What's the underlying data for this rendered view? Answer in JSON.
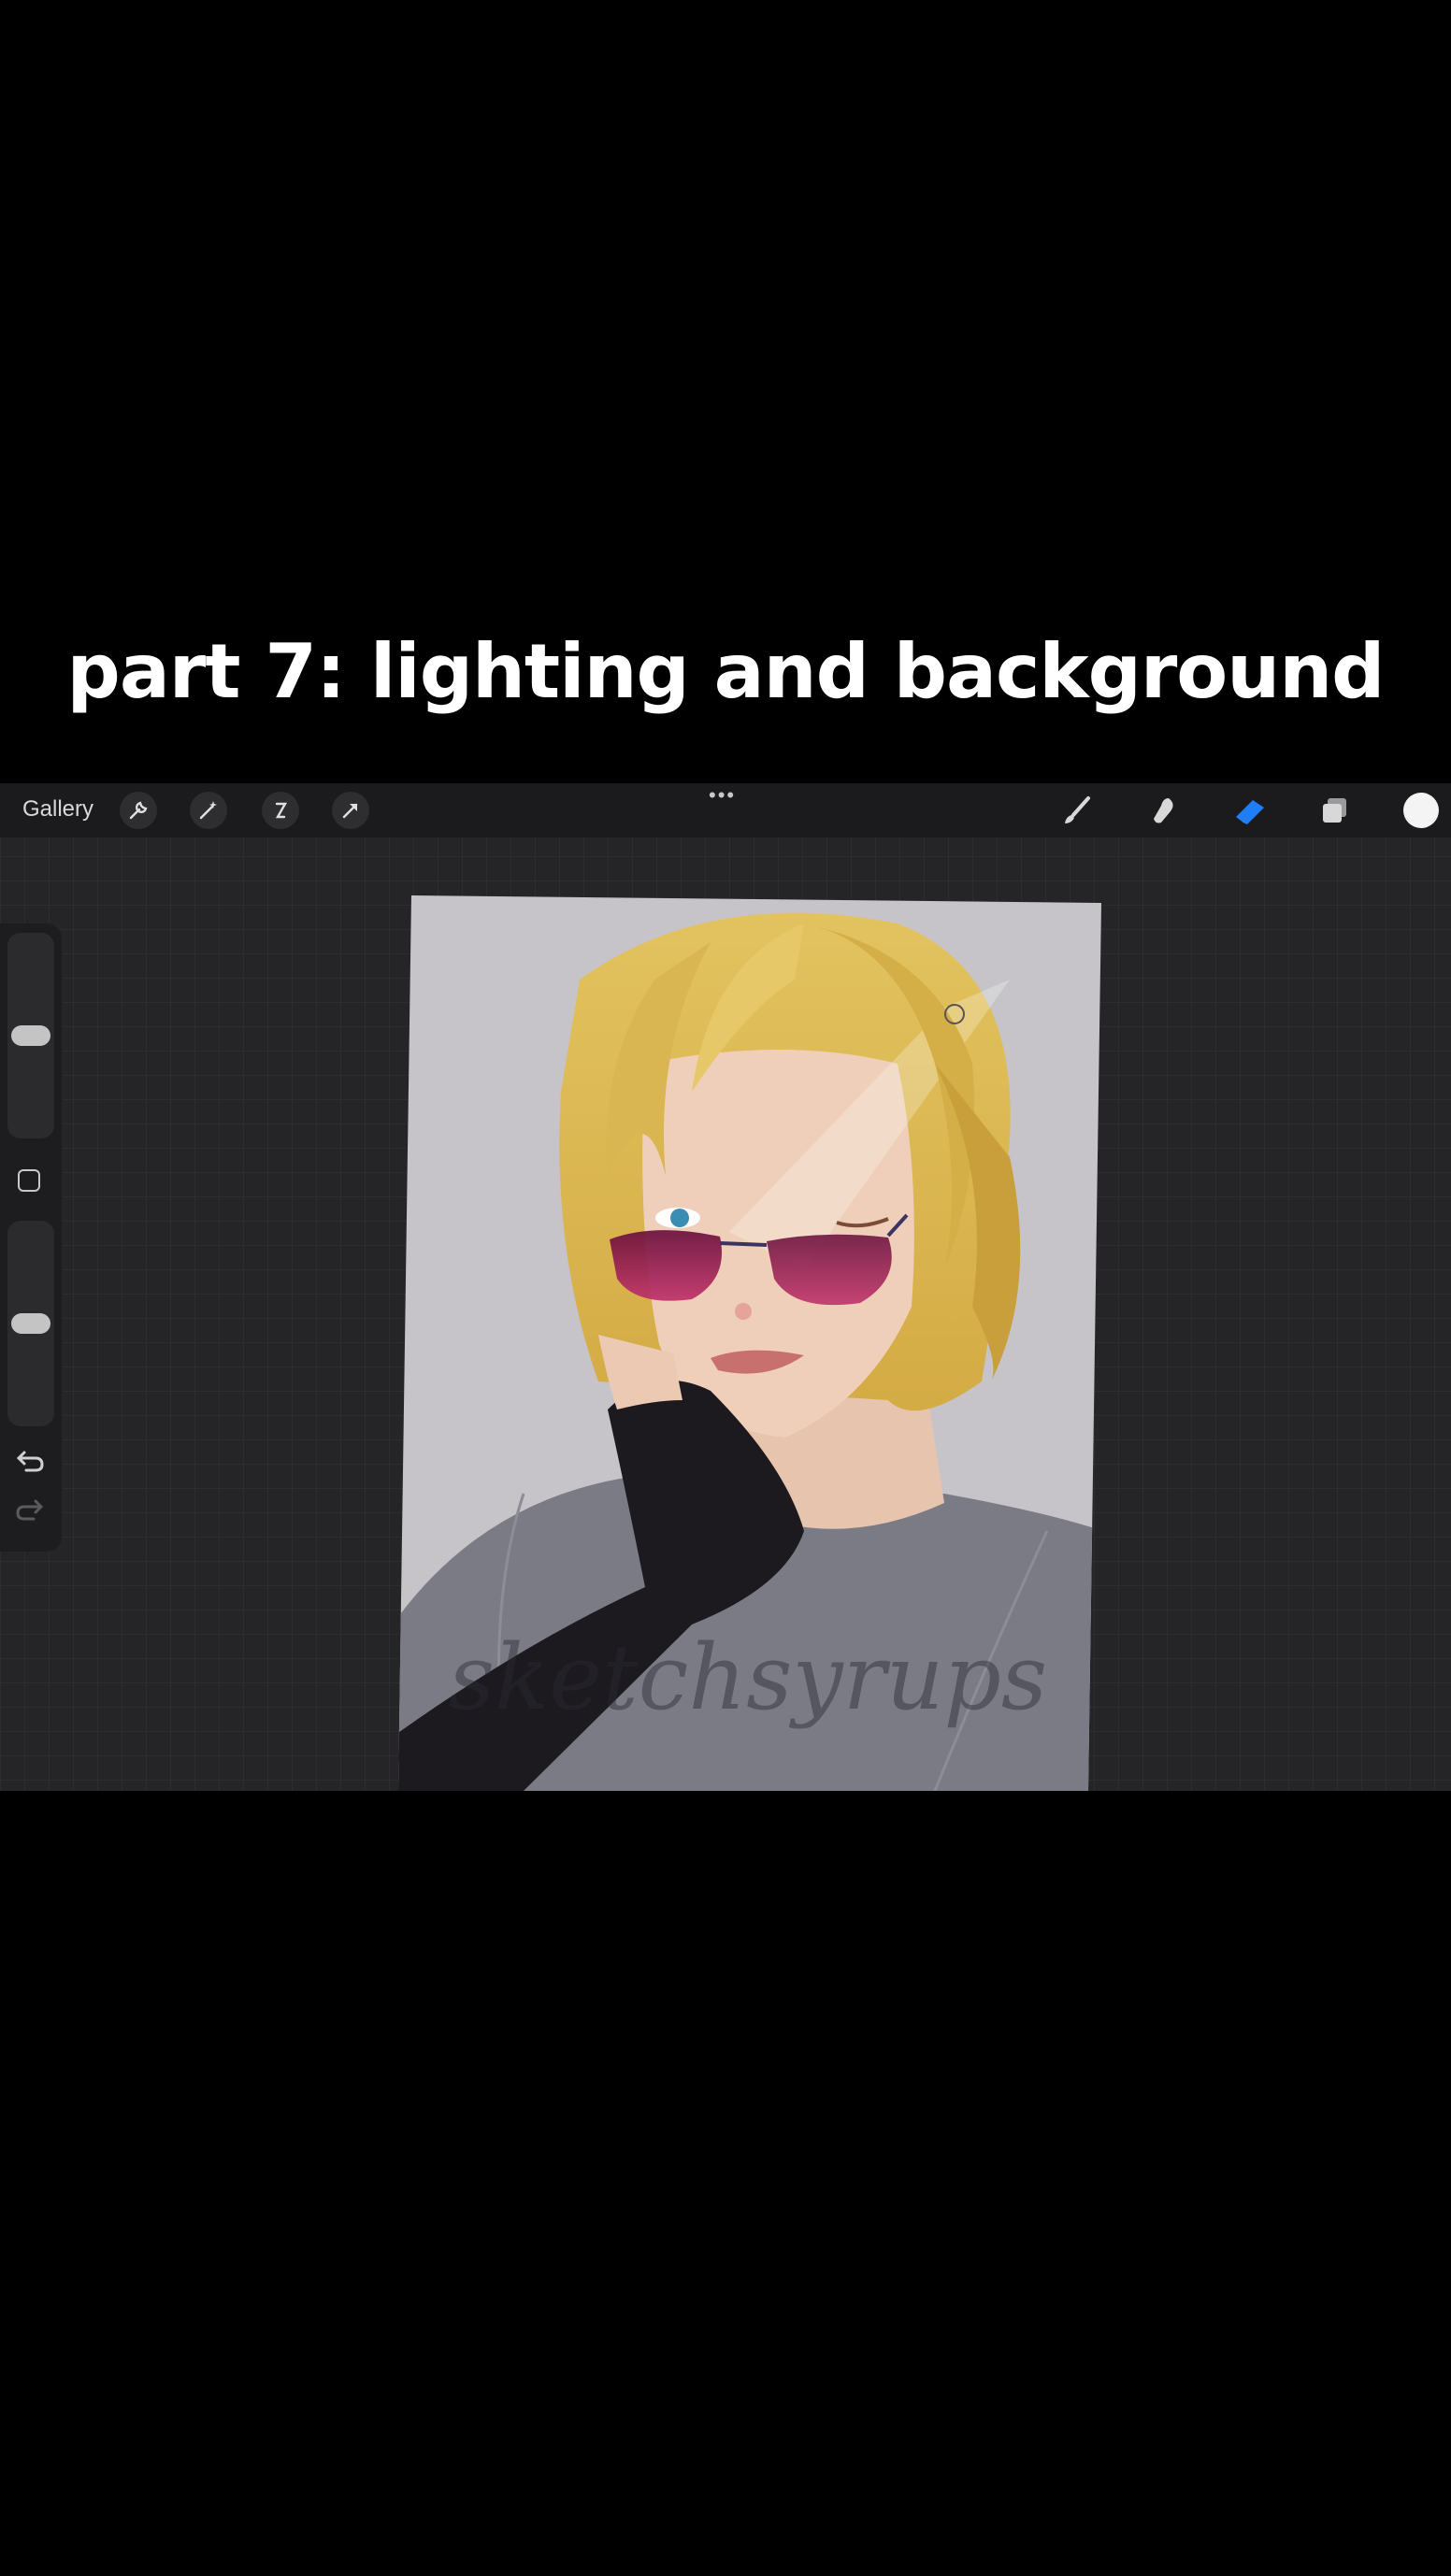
{
  "caption": "part 7: lighting and background",
  "toolbar": {
    "gallery_label": "Gallery",
    "left_tools": [
      "wrench-icon",
      "magic-wand-icon",
      "selection-icon",
      "transform-arrow-icon"
    ],
    "more_label": "•••",
    "right_tools": [
      "brush-icon",
      "smudge-icon",
      "eraser-icon",
      "layers-icon"
    ],
    "active_tool": "eraser",
    "accent_color": "#1f7ef5",
    "current_color": "#f4f4f4"
  },
  "sidebar": {
    "brush_size_level": 0.4,
    "opacity_level": 0.4,
    "icons": [
      "modify-square-icon",
      "undo-icon",
      "redo-icon"
    ]
  },
  "artwork": {
    "subject": "blonde character with purple sunglasses resting chin on hand",
    "watermark": "sketchsyrups"
  }
}
